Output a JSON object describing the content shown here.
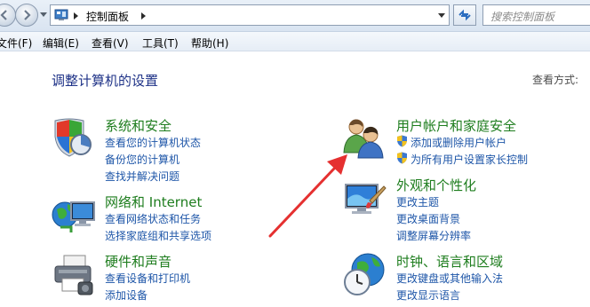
{
  "address": {
    "path_label": "控制面板",
    "search_placeholder": "搜索控制面板"
  },
  "menu": {
    "items": [
      "文件(F)",
      "编辑(E)",
      "查看(V)",
      "工具(T)",
      "帮助(H)"
    ]
  },
  "main": {
    "title": "调整计算机的设置",
    "view_by_label": "查看方式:"
  },
  "categories": [
    {
      "title": "系统和安全",
      "icon": "shield-icon",
      "links": [
        "查看您的计算机状态",
        "备份您的计算机",
        "查找并解决问题"
      ]
    },
    {
      "title": "网络和 Internet",
      "icon": "network-globe-icon",
      "links": [
        "查看网络状态和任务",
        "选择家庭组和共享选项"
      ]
    },
    {
      "title": "硬件和声音",
      "icon": "printer-icon",
      "links": [
        "查看设备和打印机",
        "添加设备"
      ]
    },
    {
      "title": "用户帐户和家庭安全",
      "icon": "users-icon",
      "links": [
        "添加或删除用户帐户",
        "为所有用户设置家长控制"
      ]
    },
    {
      "title": "外观和个性化",
      "icon": "monitor-brush-icon",
      "links": [
        "更改主题",
        "更改桌面背景",
        "调整屏幕分辨率"
      ]
    },
    {
      "title": "时钟、语言和区域",
      "icon": "clock-globe-icon",
      "links": [
        "更改键盘或其他输入法",
        "更改显示语言"
      ]
    }
  ],
  "colors": {
    "category_title": "#1e7d1e",
    "link": "#1e56a8",
    "page_title": "#1e3287",
    "annotation_arrow": "#e53030"
  }
}
